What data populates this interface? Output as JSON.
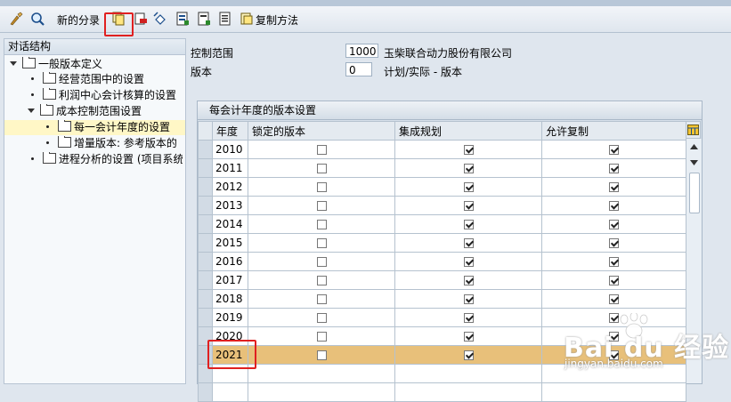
{
  "toolbar": {
    "new_entries_label": "新的分录",
    "copy_method_label": "复制方法",
    "icons": [
      "display-change-icon",
      "find-icon",
      "copy-icon",
      "delete-icon",
      "undo-icon",
      "select-all-icon",
      "deselect-icon",
      "select-block-icon",
      "copy-method-icon"
    ]
  },
  "tree": {
    "header": "对话结构",
    "items": [
      {
        "label": "一般版本定义",
        "level": 0,
        "expanded": true
      },
      {
        "label": "经营范围中的设置",
        "level": 1
      },
      {
        "label": "利润中心会计核算的设置",
        "level": 1
      },
      {
        "label": "成本控制范围设置",
        "level": 1,
        "expanded": true
      },
      {
        "label": "每一会计年度的设置",
        "level": 2,
        "selected": true
      },
      {
        "label": "增量版本: 参考版本的",
        "level": 2
      },
      {
        "label": "进程分析的设置 (项目系统",
        "level": 1
      }
    ]
  },
  "fields": {
    "controlling_area_label": "控制范围",
    "controlling_area_value": "1000",
    "controlling_area_desc": "玉柴联合动力股份有限公司",
    "version_label": "版本",
    "version_value": "0",
    "version_desc": "计划/实际 - 版本"
  },
  "table": {
    "title": "每会计年度的版本设置",
    "columns": [
      "年度",
      "锁定的版本",
      "集成规划",
      "允许复制"
    ],
    "rows": [
      {
        "year": "2010",
        "locked": false,
        "integrated": true,
        "copy": true
      },
      {
        "year": "2011",
        "locked": false,
        "integrated": true,
        "copy": true
      },
      {
        "year": "2012",
        "locked": false,
        "integrated": true,
        "copy": true
      },
      {
        "year": "2013",
        "locked": false,
        "integrated": true,
        "copy": true
      },
      {
        "year": "2014",
        "locked": false,
        "integrated": true,
        "copy": true
      },
      {
        "year": "2015",
        "locked": false,
        "integrated": true,
        "copy": true
      },
      {
        "year": "2016",
        "locked": false,
        "integrated": true,
        "copy": true
      },
      {
        "year": "2017",
        "locked": false,
        "integrated": true,
        "copy": true
      },
      {
        "year": "2018",
        "locked": false,
        "integrated": true,
        "copy": true
      },
      {
        "year": "2019",
        "locked": false,
        "integrated": true,
        "copy": true
      },
      {
        "year": "2020",
        "locked": false,
        "integrated": true,
        "copy": true
      },
      {
        "year": "2021",
        "locked": false,
        "integrated": true,
        "copy": true,
        "highlighted": true
      }
    ]
  },
  "watermark": {
    "brand": "Bai du 经验",
    "url": "jingyan.baidu.com"
  },
  "colors": {
    "highlight_row": "#e8c07a",
    "annotation_red": "#e02020",
    "selected_tree": "#fff7c6"
  }
}
